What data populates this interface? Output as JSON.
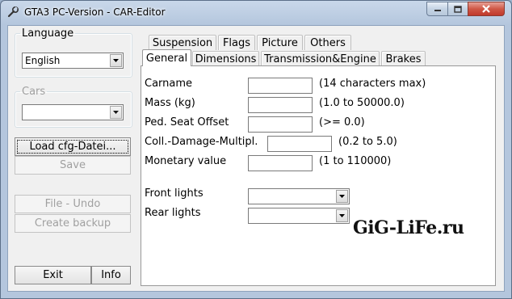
{
  "window": {
    "title": "GTA3 PC-Version - CAR-Editor"
  },
  "colors": {
    "titlebar": "#b4c6dd",
    "close_button": "#c0392b",
    "client": "#f0f0f0"
  },
  "icons": {
    "app": "wrench-icon",
    "minimize": "minimize-icon",
    "maximize": "maximize-icon",
    "close": "close-icon"
  },
  "sidebar": {
    "language_label": "Language",
    "language_value": "English",
    "cars_label": "Cars",
    "cars_value": "",
    "load_label": "Load cfg-Datei...",
    "save_label": "Save",
    "undo_label": "File - Undo",
    "backup_label": "Create backup",
    "exit_label": "Exit",
    "info_label": "Info"
  },
  "tabs": {
    "row_back": [
      "Suspension",
      "Flags",
      "Picture",
      "Others"
    ],
    "row_front": [
      "General",
      "Dimensions",
      "Transmission&Engine",
      "Brakes"
    ],
    "active": "General"
  },
  "general": {
    "fields": [
      {
        "label": "Carname",
        "value": "",
        "hint": "(14 characters max)"
      },
      {
        "label": "Mass (kg)",
        "value": "",
        "hint": "(1.0 to 50000.0)"
      },
      {
        "label": "Ped. Seat Offset",
        "value": "",
        "hint": "(>= 0.0)"
      },
      {
        "label": "Coll.-Damage-Multipl.",
        "value": "",
        "hint": "(0.2 to 5.0)"
      },
      {
        "label": "Monetary value",
        "value": "",
        "hint": "(1 to 110000)"
      }
    ],
    "front_lights_label": "Front lights",
    "front_lights_value": "",
    "rear_lights_label": "Rear lights",
    "rear_lights_value": ""
  },
  "watermark": "GiG-LiFe.ru"
}
